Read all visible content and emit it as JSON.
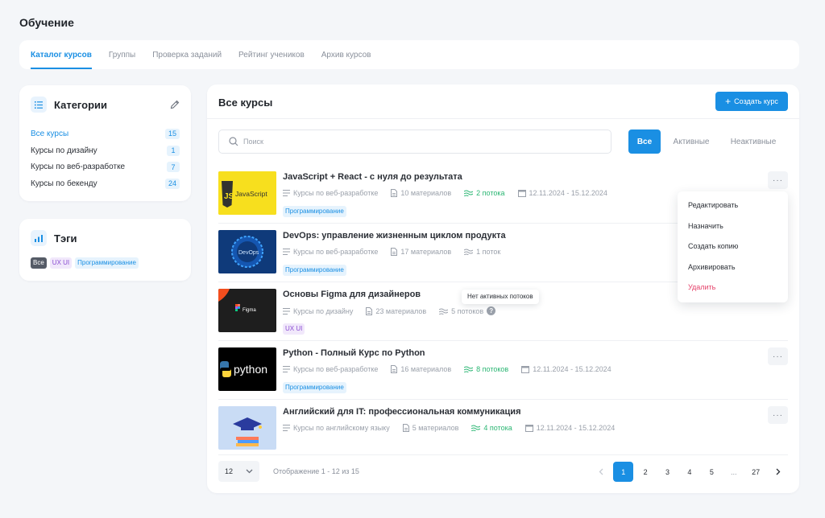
{
  "page_title": "Обучение",
  "tabs": [
    {
      "label": "Каталог курсов",
      "active": true
    },
    {
      "label": "Группы"
    },
    {
      "label": "Проверка заданий"
    },
    {
      "label": "Рейтинг учеников"
    },
    {
      "label": "Архив курсов"
    }
  ],
  "categories": {
    "title": "Категории",
    "icon": "list-icon",
    "items": [
      {
        "label": "Все курсы",
        "count": "15",
        "active": true
      },
      {
        "label": "Курсы по дизайну",
        "count": "1"
      },
      {
        "label": "Курсы по веб-разработке",
        "count": "7"
      },
      {
        "label": "Курсы по бекенду",
        "count": "24"
      }
    ]
  },
  "tags": {
    "title": "Тэги",
    "icon": "bar-chart-icon",
    "items": [
      "Все",
      "UX UI",
      "Программирование"
    ]
  },
  "main": {
    "title": "Все курсы",
    "create_label": "Создать курс",
    "search_placeholder": "Поиск",
    "filters": [
      "Все",
      "Активные",
      "Неактивные"
    ]
  },
  "courses": [
    {
      "title": "JavaScript + React - с нуля до результата",
      "category": "Курсы по веб-разработке",
      "materials": "10 материалов",
      "streams": "2 потока",
      "streams_active": true,
      "dates": "12.11.2024 - 15.12.2024",
      "tag": "Программирование",
      "thumb_text": "JavaScript"
    },
    {
      "title": "DevOps: управление жизненным циклом продукта",
      "category": "Курсы по веб-разработке",
      "materials": "17 материалов",
      "streams": "1 поток",
      "streams_active": false,
      "dates": "",
      "tag": "Программирование",
      "thumb_text": "DevOps"
    },
    {
      "title": "Основы Figma для дизайнеров",
      "category": "Курсы по дизайну",
      "materials": "23 материалов",
      "streams": "5 потоков",
      "streams_active": false,
      "dates": "",
      "tag": "UX UI",
      "thumb_text": "Figma"
    },
    {
      "title": "Python - Полный Курс по Python",
      "category": "Курсы по веб-разработке",
      "materials": "16 материалов",
      "streams": "8 потоков",
      "streams_active": true,
      "dates": "12.11.2024 - 15.12.2024",
      "tag": "Программирование",
      "thumb_text": "python"
    },
    {
      "title": "Английский для IT: профессиональная коммуникация",
      "category": "Курсы по английскому языку",
      "materials": "5 материалов",
      "streams": "4 потока",
      "streams_active": true,
      "dates": "12.11.2024 - 15.12.2024",
      "tag": "",
      "thumb_text": ""
    }
  ],
  "context_menu": [
    "Редактировать",
    "Назначить",
    "Создать копию",
    "Архивировать",
    "Удалить"
  ],
  "tooltip": "Нет активных потоков",
  "footer": {
    "per_page": "12",
    "showing": "Отображение 1 - 12 из 15",
    "pages": [
      "1",
      "2",
      "3",
      "4",
      "5",
      "...",
      "27"
    ],
    "current_page": "1"
  },
  "colors": {
    "accent": "#1a8fe3",
    "success": "#2bb673",
    "danger": "#e5436b"
  }
}
